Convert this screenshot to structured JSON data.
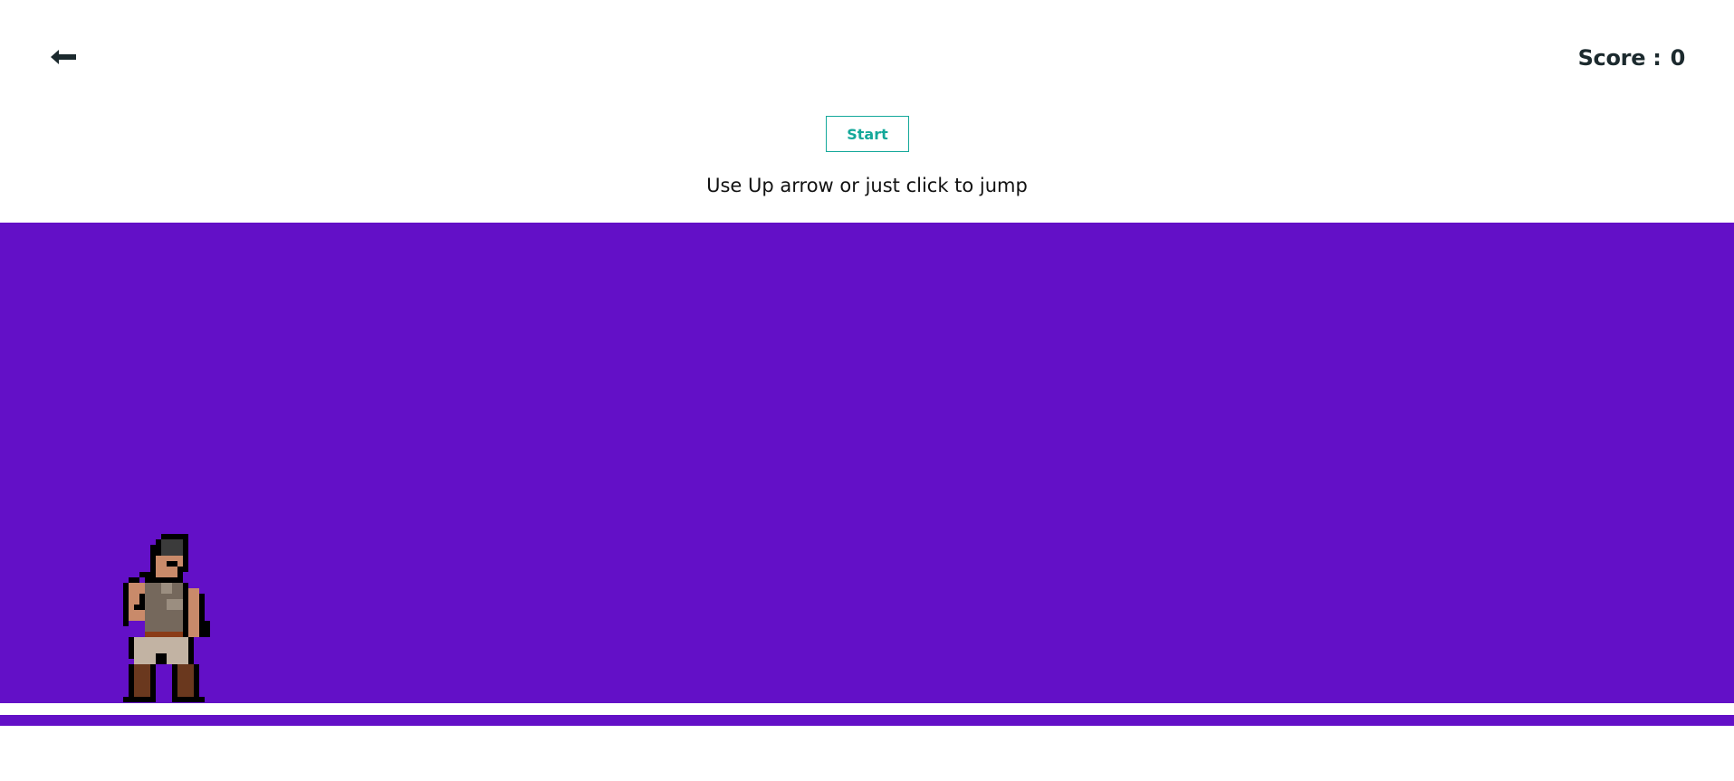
{
  "header": {
    "back_icon": "arrow-left-icon",
    "score_label": "Score :",
    "score_value": "0"
  },
  "controls": {
    "start_label": "Start",
    "instructions": "Use Up arrow or just click to jump"
  },
  "game": {
    "background_color": "#6310c7",
    "ground_color": "#6310c7",
    "player_sprite": "pixel-art-warrior"
  },
  "colors": {
    "accent": "#14a89a",
    "text_dark": "#1c2a2e"
  }
}
